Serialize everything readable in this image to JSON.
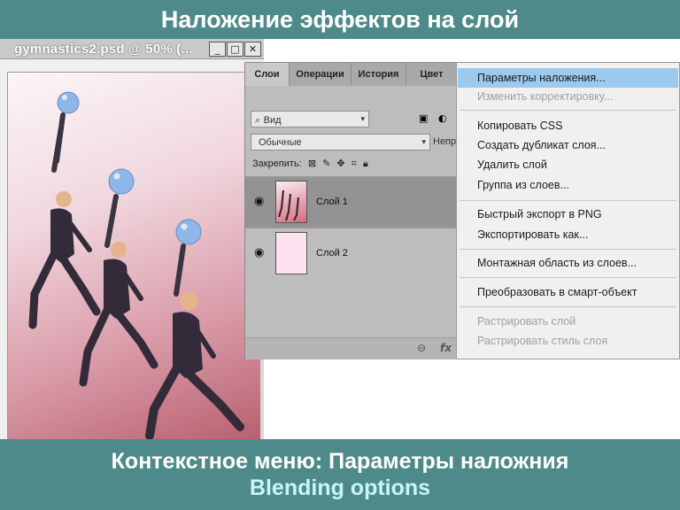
{
  "slide": {
    "title": "Наложение эффектов на слой",
    "caption_line1": "Контекстное меню: Параметры наложния",
    "caption_line2": "Blending options"
  },
  "document_window": {
    "title": "gymnastics2.psd @ 50% (...",
    "minimize": "_",
    "maximize": "□",
    "close": "✕"
  },
  "layers_panel": {
    "tabs": [
      "Слои",
      "Операции",
      "История",
      "Цвет"
    ],
    "active_tab": "Слои",
    "filter_label": "Вид",
    "blend_mode": "Обычные",
    "opacity_label": "Непр",
    "lock_label": "Закрепить:",
    "layers": [
      {
        "name": "Слой 1",
        "selected": true
      },
      {
        "name": "Слой 2",
        "selected": false
      }
    ],
    "footer_icons": [
      "link-icon",
      "fx-icon"
    ]
  },
  "context_menu": {
    "items": [
      {
        "label": "Параметры наложения...",
        "state": "highlighted"
      },
      {
        "label": "Изменить корректировку...",
        "state": "disabled"
      },
      {
        "label": "Копировать CSS",
        "state": "normal"
      },
      {
        "label": "Создать дубликат слоя...",
        "state": "normal"
      },
      {
        "label": "Удалить слой",
        "state": "normal"
      },
      {
        "label": "Группа из слоев...",
        "state": "normal"
      },
      {
        "label": "Быстрый экспорт в PNG",
        "state": "normal"
      },
      {
        "label": "Экспортировать как...",
        "state": "normal"
      },
      {
        "label": "Монтажная область из слоев...",
        "state": "normal"
      },
      {
        "label": "Преобразовать в смарт-объект",
        "state": "normal"
      },
      {
        "label": "Растрировать слой",
        "state": "disabled"
      },
      {
        "label": "Растрировать стиль слоя",
        "state": "disabled"
      }
    ]
  },
  "colors": {
    "banner": "#4f8a8b",
    "highlight": "#9cc9ee",
    "caption_accent": "#c8f5f5"
  }
}
